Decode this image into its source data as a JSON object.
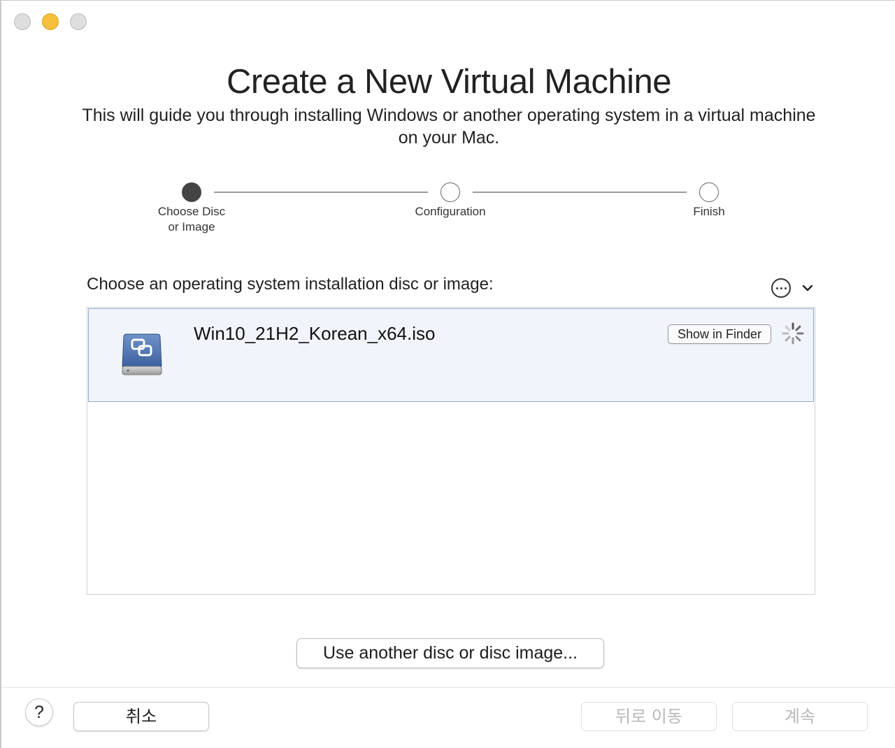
{
  "window": {
    "traffic_lights": [
      "close",
      "minimize",
      "zoom"
    ],
    "minimize_color": "#f6bf3c"
  },
  "header": {
    "title": "Create a New Virtual Machine",
    "subtitle_line1": "This will guide you through installing Windows or another operating system in a virtual machine",
    "subtitle_line2": "on your Mac."
  },
  "steps": [
    {
      "label_line1": "Choose Disc",
      "label_line2": "or Image",
      "state": "active"
    },
    {
      "label_line1": "Configuration",
      "label_line2": "",
      "state": "pending"
    },
    {
      "label_line1": "Finish",
      "label_line2": "",
      "state": "pending"
    }
  ],
  "chooser": {
    "label": "Choose an operating system installation disc or image:",
    "more_icon": "ellipsis-circle-icon",
    "chevron_icon": "chevron-down-icon"
  },
  "list": {
    "items": [
      {
        "name": "Win10_21H2_Korean_x64.iso",
        "icon": "disk-image-icon",
        "show_in_finder_label": "Show in Finder",
        "status_icon": "spinner-icon",
        "selected": true
      }
    ]
  },
  "actions": {
    "use_another_label": "Use another disc or disc image..."
  },
  "footer": {
    "help_label": "?",
    "cancel_label": "취소",
    "back_label": "뒤로 이동",
    "continue_label": "계속",
    "disabled_color": "#b8b8b8"
  }
}
